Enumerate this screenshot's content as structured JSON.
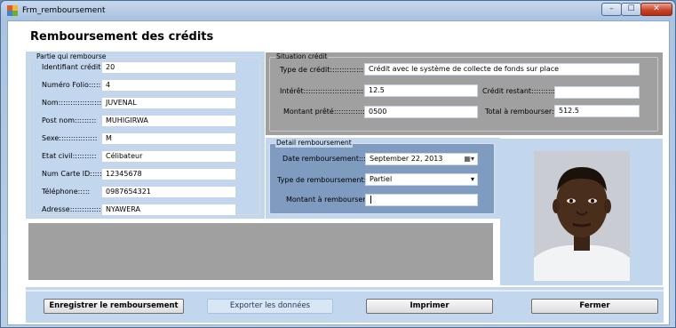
{
  "window": {
    "title": "Frm_remboursement",
    "controls": {
      "minimize": "–",
      "maximize": "☐",
      "close": "✕"
    }
  },
  "form": {
    "heading": "Remboursement des crédits"
  },
  "debtor": {
    "legend": "Partie qui rembourse",
    "fields": [
      {
        "label": "Identifiant crédit:::::",
        "value": "20"
      },
      {
        "label": "Numéro Folio:::::",
        "value": "4"
      },
      {
        "label": "Nom::::::::::::::::::",
        "value": "JUVENAL"
      },
      {
        "label": "Post nom:::::::::",
        "value": "MUHIGIRWA"
      },
      {
        "label": "Sexe::::::::::::::::",
        "value": "M"
      },
      {
        "label": "Etat civil::::::::::",
        "value": "Célibateur"
      },
      {
        "label": "Num Carte ID:::::",
        "value": "12345678"
      },
      {
        "label": "Téléphone:::::",
        "value": "0987654321"
      },
      {
        "label": "Adresse:::::::::::::",
        "value": "NYAWERA"
      }
    ]
  },
  "situation": {
    "legend": "Situation crédit",
    "type_label": "Type de crédit::::::::::::::::",
    "type_value": "Crédit avec le système de collecte de fonds sur place",
    "interest_label": "Intérêt:::::::::::::::::::::::::::::",
    "interest_value": "12.5",
    "remaining_label": "Crédit restant::::::::::::",
    "remaining_value": "",
    "loan_label": "Montant prêté::::::::::::::::",
    "loan_value": "0500",
    "total_label": "Total à rembourser::::",
    "total_value": "512.5"
  },
  "detail": {
    "legend": "Detail remboursement",
    "date_label": "Date remboursement::::::",
    "date_value": "September 22, 2013",
    "type_label": "Type de remboursement::",
    "type_value": "Partiel",
    "amount_label": "Montant à rembourser:::",
    "amount_value": ""
  },
  "buttons": {
    "save": "Enregistrer le remboursement",
    "export": "Exporter les données",
    "print": "Imprimer",
    "close": "Fermer"
  }
}
